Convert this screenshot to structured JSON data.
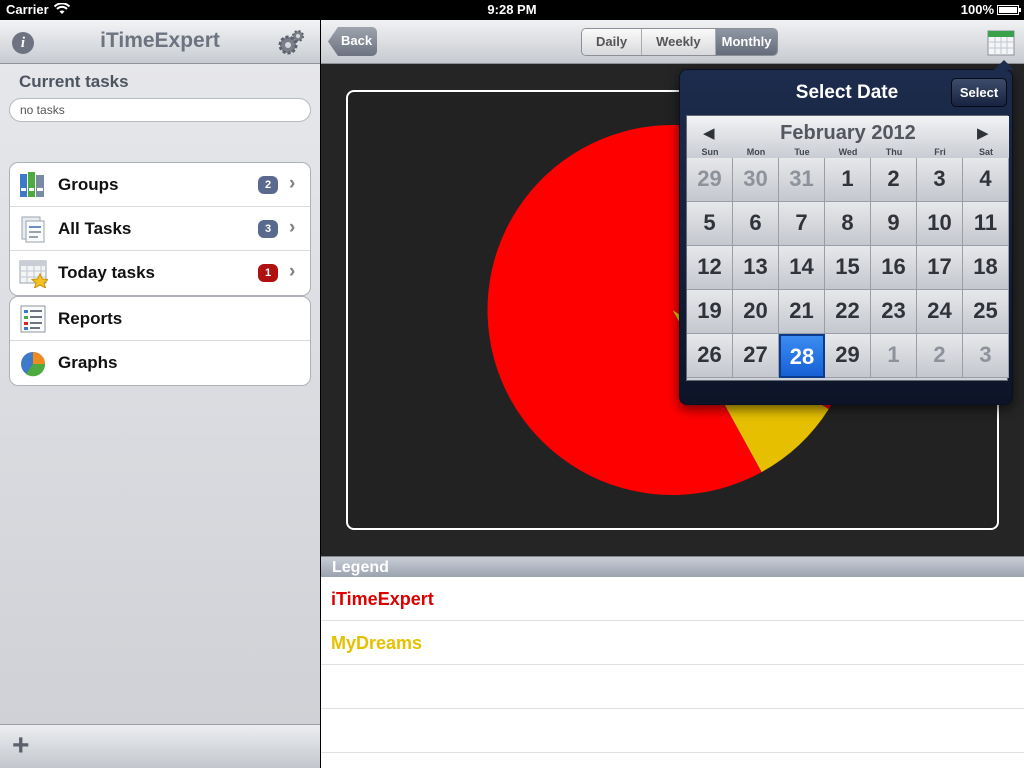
{
  "status": {
    "carrier": "Carrier",
    "time": "9:28 PM",
    "battery": "100%"
  },
  "left": {
    "title": "iTimeExpert",
    "current_label": "Current tasks",
    "no_tasks": "no tasks",
    "menu1": [
      {
        "label": "Groups",
        "badge": "2",
        "badge_color": "#5a6a8f"
      },
      {
        "label": "All Tasks",
        "badge": "3",
        "badge_color": "#5a6a8f"
      },
      {
        "label": "Today tasks",
        "badge": "1",
        "badge_color": "#b01010"
      }
    ],
    "menu2": [
      {
        "label": "Reports"
      },
      {
        "label": "Graphs"
      }
    ],
    "add_icon": "plus-icon"
  },
  "right": {
    "back": "Back",
    "segments": [
      "Daily",
      "Weekly",
      "Monthly"
    ],
    "active_segment": "Monthly",
    "legend_title": "Legend",
    "legend": [
      {
        "name": "iTimeExpert",
        "color": "#dd0000"
      },
      {
        "name": "MyDreams",
        "color": "#e6c000"
      }
    ]
  },
  "chart_data": {
    "type": "pie",
    "slices": [
      {
        "label": "iTimeExpert",
        "value": 92,
        "color": "#ff0000"
      },
      {
        "label": "MyDreams",
        "value": 8,
        "color": "#e6c000"
      }
    ]
  },
  "popover": {
    "title": "Select Date",
    "select": "Select",
    "month": "February 2012",
    "weekdays": [
      "Sun",
      "Mon",
      "Tue",
      "Wed",
      "Thu",
      "Fri",
      "Sat"
    ],
    "days": [
      {
        "d": "29",
        "o": true
      },
      {
        "d": "30",
        "o": true
      },
      {
        "d": "31",
        "o": true
      },
      {
        "d": "1"
      },
      {
        "d": "2"
      },
      {
        "d": "3"
      },
      {
        "d": "4"
      },
      {
        "d": "5"
      },
      {
        "d": "6"
      },
      {
        "d": "7"
      },
      {
        "d": "8"
      },
      {
        "d": "9"
      },
      {
        "d": "10"
      },
      {
        "d": "11"
      },
      {
        "d": "12"
      },
      {
        "d": "13"
      },
      {
        "d": "14"
      },
      {
        "d": "15"
      },
      {
        "d": "16"
      },
      {
        "d": "17"
      },
      {
        "d": "18"
      },
      {
        "d": "19"
      },
      {
        "d": "20"
      },
      {
        "d": "21"
      },
      {
        "d": "22"
      },
      {
        "d": "23"
      },
      {
        "d": "24"
      },
      {
        "d": "25"
      },
      {
        "d": "26"
      },
      {
        "d": "27"
      },
      {
        "d": "28",
        "s": true
      },
      {
        "d": "29"
      },
      {
        "d": "1",
        "o": true
      },
      {
        "d": "2",
        "o": true
      },
      {
        "d": "3",
        "o": true
      }
    ]
  }
}
